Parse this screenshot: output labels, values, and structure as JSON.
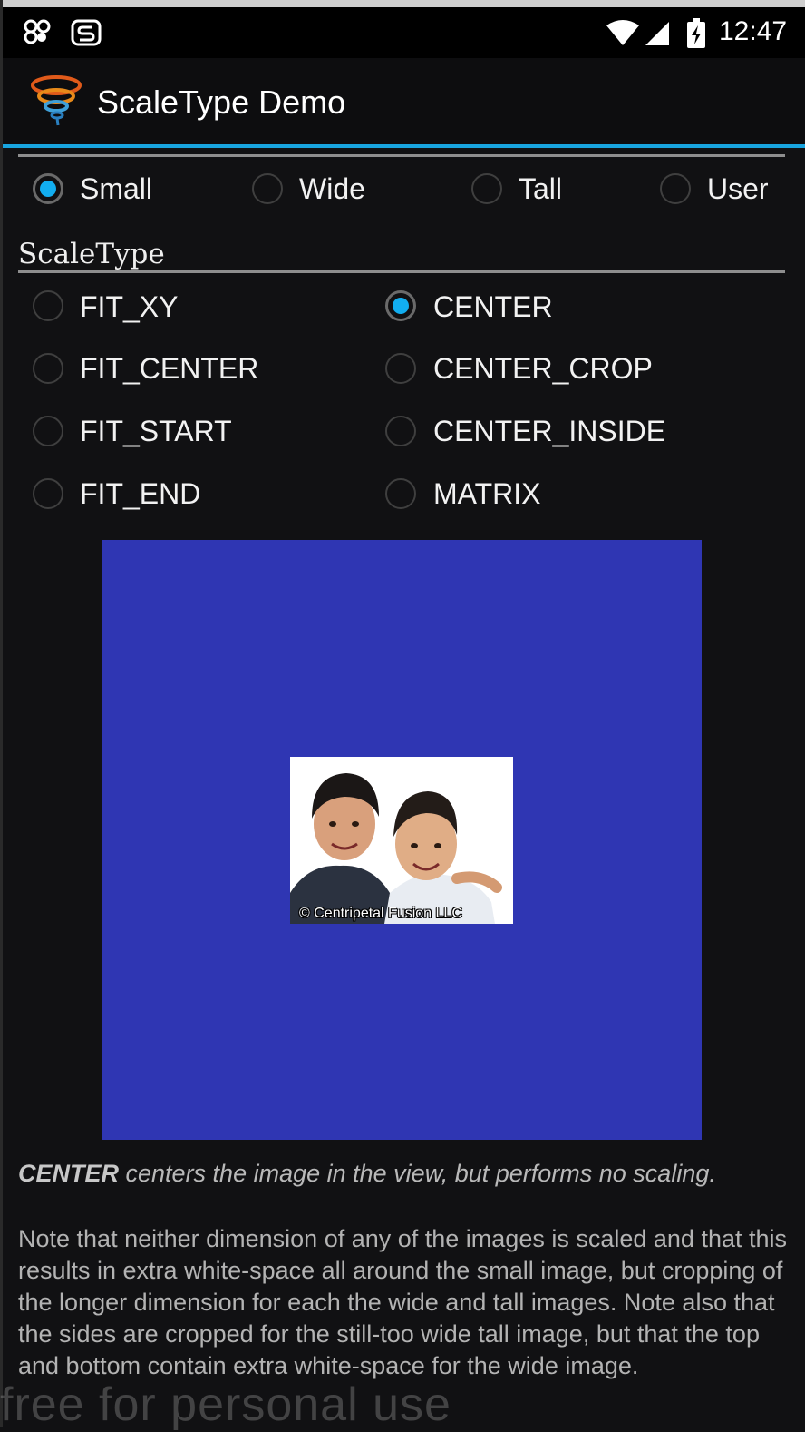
{
  "status_bar": {
    "time": "12:47",
    "icons": [
      "notification-app-icon",
      "notification-s-icon",
      "wifi-icon",
      "signal-icon",
      "battery-charging-icon"
    ]
  },
  "app": {
    "title": "ScaleType Demo",
    "icon": "app-icon"
  },
  "image_size_group": {
    "options": [
      {
        "label": "Small",
        "checked": true
      },
      {
        "label": "Wide",
        "checked": false
      },
      {
        "label": "Tall",
        "checked": false
      },
      {
        "label": "User",
        "checked": false
      }
    ]
  },
  "scale_type_group": {
    "header": "ScaleType",
    "options": [
      {
        "label": "FIT_XY",
        "checked": false
      },
      {
        "label": "CENTER",
        "checked": true
      },
      {
        "label": "FIT_CENTER",
        "checked": false
      },
      {
        "label": "CENTER_CROP",
        "checked": false
      },
      {
        "label": "FIT_START",
        "checked": false
      },
      {
        "label": "CENTER_INSIDE",
        "checked": false
      },
      {
        "label": "FIT_END",
        "checked": false
      },
      {
        "label": "MATRIX",
        "checked": false
      }
    ]
  },
  "image_view": {
    "background_color": "#2f36b3",
    "copyright": "© Centripetal Fusion LLC"
  },
  "description": {
    "term": "CENTER",
    "text": " centers the image in the view, but performs no scaling."
  },
  "note": "Note that neither dimension of any of the images is scaled and that this results in extra white-space all around the small image, but cropping of the longer dimension for each the wide and tall images. Note also that the sides are cropped for the still-too wide tall image, but that the top and bottom contain extra white-space for the wide image.",
  "watermark": "free for personal use",
  "colors": {
    "accent": "#18a5e0",
    "radio_checked": "#12aef0",
    "background": "#111113"
  }
}
